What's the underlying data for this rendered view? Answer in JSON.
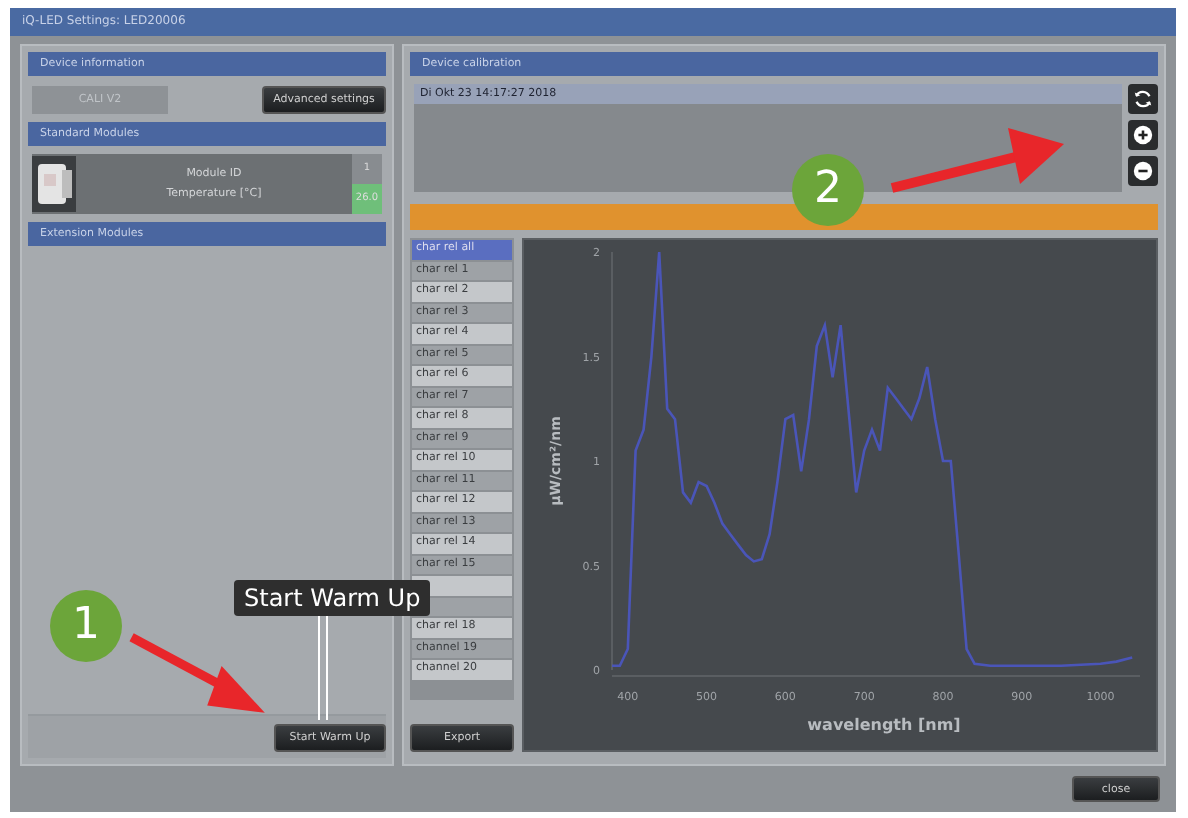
{
  "window": {
    "title": "iQ-LED Settings: LED20006"
  },
  "device_information": {
    "title": "Device information",
    "calibration_name": "CALI V2",
    "advanced_button": "Advanced settings"
  },
  "standard_modules": {
    "title": "Standard Modules",
    "modules": [
      {
        "labels": [
          "Module ID",
          "Temperature [°C]"
        ],
        "values": [
          "1",
          "26.0"
        ]
      }
    ]
  },
  "extension_modules": {
    "title": "Extension Modules",
    "button": "Start Warm Up"
  },
  "device_calibration": {
    "title": "Device calibration",
    "log": "Di Okt 23 14:17:27 2018",
    "channels": [
      {
        "label": "char rel all",
        "selected": true
      },
      {
        "label": "char rel 1",
        "selected": false
      },
      {
        "label": "char rel 2",
        "selected": false
      },
      {
        "label": "char rel 3",
        "selected": false
      },
      {
        "label": "char rel 4",
        "selected": false
      },
      {
        "label": "char rel 5",
        "selected": false
      },
      {
        "label": "char rel 6",
        "selected": false
      },
      {
        "label": "char rel 7",
        "selected": false
      },
      {
        "label": "char rel 8",
        "selected": false
      },
      {
        "label": "char rel 9",
        "selected": false
      },
      {
        "label": "char rel 10",
        "selected": false
      },
      {
        "label": "char rel 11",
        "selected": false
      },
      {
        "label": "char rel 12",
        "selected": false
      },
      {
        "label": "char rel 13",
        "selected": false
      },
      {
        "label": "char rel 14",
        "selected": false
      },
      {
        "label": "char rel 15",
        "selected": false
      },
      {
        "selected": false
      },
      {
        "selected": false
      },
      {
        "label": "char rel 18",
        "selected": false
      },
      {
        "label": "channel 19",
        "selected": false
      },
      {
        "label": "channel 20",
        "selected": false
      }
    ],
    "export_button": "Export",
    "chart_data": {
      "type": "line",
      "xlabel": "wavelength [nm]",
      "ylabel": "µW/cm²/nm",
      "xlim": [
        380,
        1050
      ],
      "ylim": [
        0,
        2
      ],
      "xticks": [
        400,
        500,
        600,
        700,
        800,
        900,
        1000
      ],
      "yticks": [
        0,
        0.5,
        1,
        1.5,
        2
      ],
      "x": [
        380,
        390,
        400,
        410,
        420,
        430,
        440,
        450,
        460,
        470,
        480,
        490,
        500,
        510,
        520,
        530,
        540,
        550,
        560,
        570,
        580,
        590,
        600,
        610,
        620,
        630,
        640,
        650,
        660,
        670,
        680,
        690,
        700,
        710,
        720,
        730,
        740,
        750,
        760,
        770,
        780,
        790,
        800,
        810,
        820,
        830,
        840,
        860,
        900,
        950,
        1000,
        1020,
        1040
      ],
      "series": [
        {
          "color": "#4a55b8",
          "values": [
            0.02,
            0.02,
            0.1,
            1.05,
            1.15,
            1.5,
            2.0,
            1.25,
            1.2,
            0.85,
            0.8,
            0.9,
            0.88,
            0.8,
            0.7,
            0.65,
            0.6,
            0.55,
            0.52,
            0.53,
            0.65,
            0.9,
            1.2,
            1.22,
            0.95,
            1.2,
            1.55,
            1.65,
            1.4,
            1.65,
            1.25,
            0.85,
            1.05,
            1.15,
            1.05,
            1.35,
            1.3,
            1.25,
            1.2,
            1.3,
            1.45,
            1.2,
            1.0,
            1.0,
            0.55,
            0.1,
            0.03,
            0.02,
            0.02,
            0.02,
            0.03,
            0.04,
            0.06
          ]
        }
      ]
    }
  },
  "progress": {
    "level": 1
  },
  "close_button": "close",
  "annotations": {
    "markers": [
      "1",
      "2"
    ],
    "tooltip": "Start Warm Up"
  }
}
